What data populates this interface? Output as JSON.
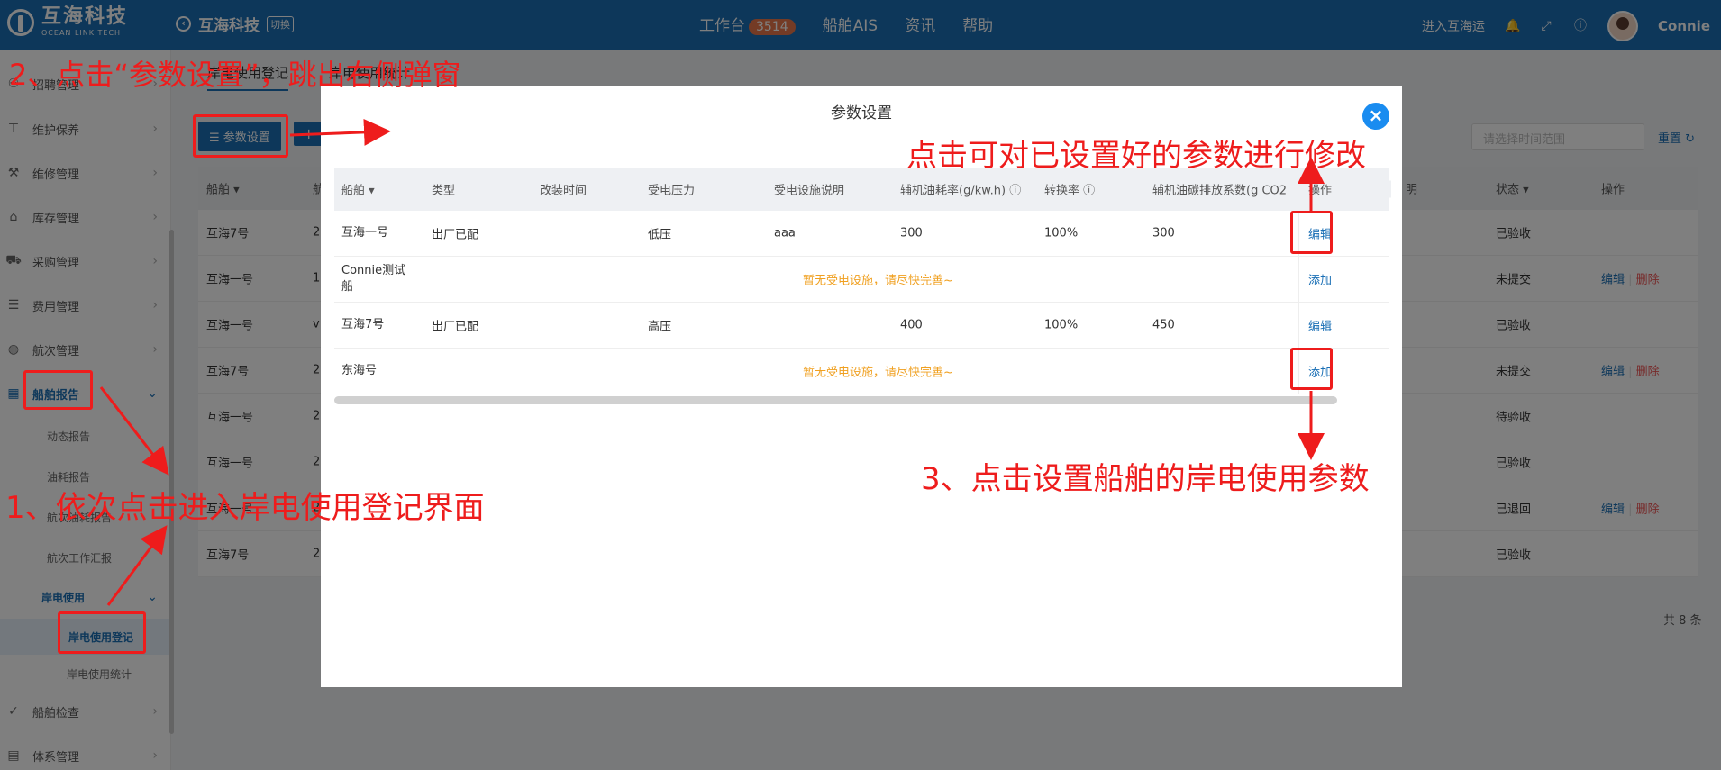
{
  "topbar": {
    "logo_name": "互海科技",
    "logo_sub": "OCEAN LINK TECH",
    "brand_name": "互海科技",
    "brand_switch": "切换",
    "nav": {
      "workbench": "工作台",
      "workbench_badge": "3514",
      "ais": "船舶AIS",
      "news": "资讯",
      "help": "帮助"
    },
    "enter_label": "进入互海运",
    "user_name": "Connie"
  },
  "sidebar": {
    "items": [
      {
        "label": "招聘管理"
      },
      {
        "label": "维护保养"
      },
      {
        "label": "维修管理"
      },
      {
        "label": "库存管理"
      },
      {
        "label": "采购管理"
      },
      {
        "label": "费用管理"
      },
      {
        "label": "航次管理"
      },
      {
        "label": "船舶报告"
      },
      {
        "label": "船舶检查"
      },
      {
        "label": "体系管理"
      }
    ],
    "subitems": [
      "动态报告",
      "油耗报告",
      "航次油耗报告",
      "航次工作汇报"
    ],
    "shore_group": "岸电使用",
    "shore_items": [
      "岸电使用登记",
      "岸电使用统计"
    ]
  },
  "main": {
    "tabs": [
      "岸电使用登记",
      "岸电使用统计"
    ],
    "param_button": "参数设置",
    "plus_button": "+",
    "date_placeholder": "请选择时间范围",
    "reset": "重置",
    "columns": [
      "船舶",
      "航",
      "明",
      "状态",
      "操作"
    ],
    "rows": [
      {
        "ship": "互海7号",
        "voy": "2",
        "status": "已验收",
        "ops": []
      },
      {
        "ship": "互海一号",
        "voy": "1",
        "status": "未提交",
        "ops": [
          "编辑",
          "删除"
        ]
      },
      {
        "ship": "互海一号",
        "voy": "v",
        "status": "已验收",
        "ops": []
      },
      {
        "ship": "互海7号",
        "voy": "2",
        "status": "未提交",
        "ops": [
          "编辑",
          "删除"
        ]
      },
      {
        "ship": "互海一号",
        "voy": "2",
        "status": "待验收",
        "ops": []
      },
      {
        "ship": "互海一号",
        "voy": "2",
        "status": "已验收",
        "ops": []
      },
      {
        "ship": "互海一号",
        "voy": "2",
        "status": "已退回",
        "ops": [
          "编辑",
          "删除"
        ]
      },
      {
        "ship": "互海7号",
        "voy": "2",
        "status": "已验收",
        "ops": []
      }
    ],
    "total": "共 8 条"
  },
  "modal": {
    "title": "参数设置",
    "columns": [
      "船舶",
      "类型",
      "改装时间",
      "受电压力",
      "受电设施说明",
      "辅机油耗率(g/kw.h)",
      "转换率",
      "辅机油碳排放系数(g CO2",
      "操作"
    ],
    "rows": [
      {
        "ship": "互海一号",
        "type": "出厂已配",
        "time": "",
        "pressure": "低压",
        "desc": "aaa",
        "rate": "300",
        "conv": "100%",
        "coef": "300",
        "op": "编辑"
      },
      {
        "ship": "Connie测试船",
        "empty": "暂无受电设施，请尽快完善~",
        "op": "添加"
      },
      {
        "ship": "互海7号",
        "type": "出厂已配",
        "time": "",
        "pressure": "高压",
        "desc": "",
        "rate": "400",
        "conv": "100%",
        "coef": "450",
        "op": "编辑"
      },
      {
        "ship": "东海号",
        "empty": "暂无受电设施，请尽快完善~",
        "op": "添加"
      }
    ]
  },
  "annotations": {
    "step1": "1、依次点击进入岸电使用登记界面",
    "step2": "2、点击“参数设置”，跳出右侧弹窗",
    "step3": "3、点击设置船舶的岸电使用参数",
    "edit_note": "点击可对已设置好的参数进行修改"
  },
  "colors": {
    "primary": "#1a6fb5",
    "annotation": "#ee1c1c",
    "warn": "#f0a020"
  }
}
